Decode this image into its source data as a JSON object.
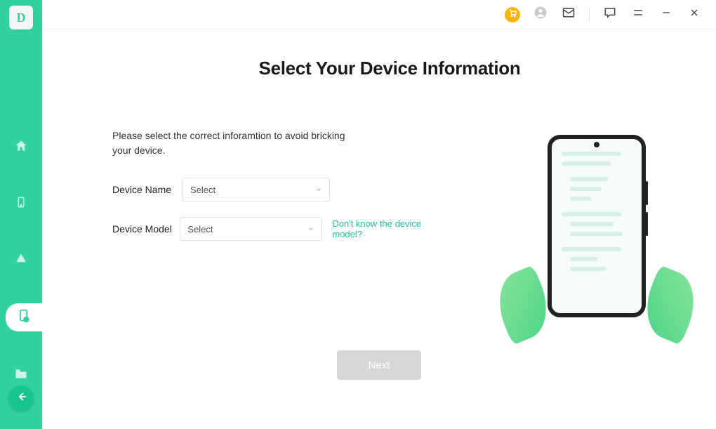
{
  "logo_letter": "D",
  "page": {
    "title": "Select Your Device Information",
    "helper": "Please select the correct inforamtion to avoid bricking your device.",
    "next_label": "Next"
  },
  "fields": {
    "device_name": {
      "label": "Device Name",
      "value": "Select"
    },
    "device_model": {
      "label": "Device Model",
      "value": "Select",
      "hint": "Don't know the device model?"
    }
  }
}
